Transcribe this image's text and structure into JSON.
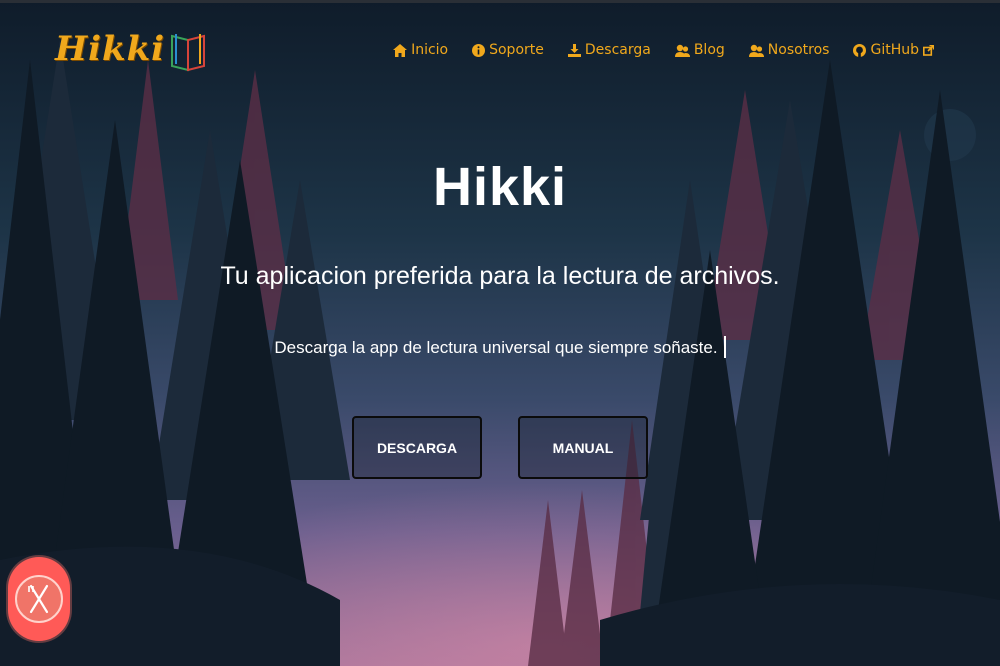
{
  "brand": {
    "logo_text": "Hikki"
  },
  "nav": {
    "items": [
      {
        "label": "Inicio",
        "icon": "home-icon"
      },
      {
        "label": "Soporte",
        "icon": "info-circle-icon"
      },
      {
        "label": "Descarga",
        "icon": "download-icon"
      },
      {
        "label": "Blog",
        "icon": "users-icon"
      },
      {
        "label": "Nosotros",
        "icon": "users-icon"
      },
      {
        "label": "GitHub",
        "icon": "github-icon",
        "external_icon": "external-link-icon"
      }
    ]
  },
  "hero": {
    "title": "Hikki",
    "subtitle": "Tu aplicacion preferida para la lectura de archivos.",
    "tagline": "Descarga la app de lectura universal que siempre soñaste.",
    "buttons": {
      "download": "DESCARGA",
      "manual": "MANUAL"
    }
  },
  "widget": {
    "icon": "close-utensils-icon"
  },
  "colors": {
    "accent": "#f0a81c",
    "text": "#ffffff",
    "widget": "#ff5a57"
  }
}
